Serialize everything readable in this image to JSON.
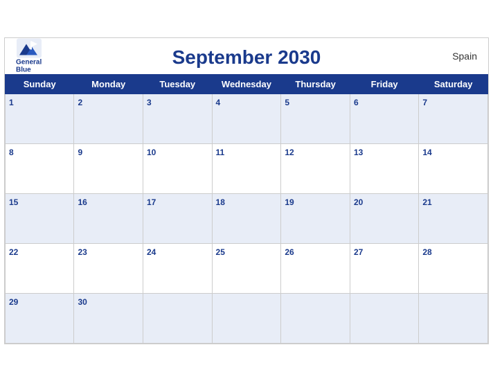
{
  "header": {
    "title": "September 2030",
    "country": "Spain",
    "logo_line1": "General",
    "logo_line2": "Blue"
  },
  "weekdays": [
    "Sunday",
    "Monday",
    "Tuesday",
    "Wednesday",
    "Thursday",
    "Friday",
    "Saturday"
  ],
  "weeks": [
    [
      {
        "day": 1
      },
      {
        "day": 2
      },
      {
        "day": 3
      },
      {
        "day": 4
      },
      {
        "day": 5
      },
      {
        "day": 6
      },
      {
        "day": 7
      }
    ],
    [
      {
        "day": 8
      },
      {
        "day": 9
      },
      {
        "day": 10
      },
      {
        "day": 11
      },
      {
        "day": 12
      },
      {
        "day": 13
      },
      {
        "day": 14
      }
    ],
    [
      {
        "day": 15
      },
      {
        "day": 16
      },
      {
        "day": 17
      },
      {
        "day": 18
      },
      {
        "day": 19
      },
      {
        "day": 20
      },
      {
        "day": 21
      }
    ],
    [
      {
        "day": 22
      },
      {
        "day": 23
      },
      {
        "day": 24
      },
      {
        "day": 25
      },
      {
        "day": 26
      },
      {
        "day": 27
      },
      {
        "day": 28
      }
    ],
    [
      {
        "day": 29
      },
      {
        "day": 30
      },
      {
        "day": null
      },
      {
        "day": null
      },
      {
        "day": null
      },
      {
        "day": null
      },
      {
        "day": null
      }
    ]
  ]
}
